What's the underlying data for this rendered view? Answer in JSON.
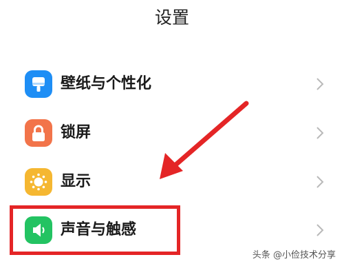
{
  "header": {
    "title": "设置"
  },
  "menu": {
    "items": [
      {
        "label": "壁纸与个性化",
        "icon": "wallpaper-icon",
        "icon_color": "#1e8ef5"
      },
      {
        "label": "锁屏",
        "icon": "lock-icon",
        "icon_color": "#f2744a"
      },
      {
        "label": "显示",
        "icon": "sun-icon",
        "icon_color": "#f5b731"
      },
      {
        "label": "声音与触感",
        "icon": "speaker-icon",
        "icon_color": "#23c362"
      }
    ],
    "chevron_icon": "chevron-right-icon"
  },
  "annotation": {
    "highlight_color": "#e42526",
    "arrow_color": "#e42526"
  },
  "watermark": {
    "text": "头条 @小俭技术分享"
  }
}
